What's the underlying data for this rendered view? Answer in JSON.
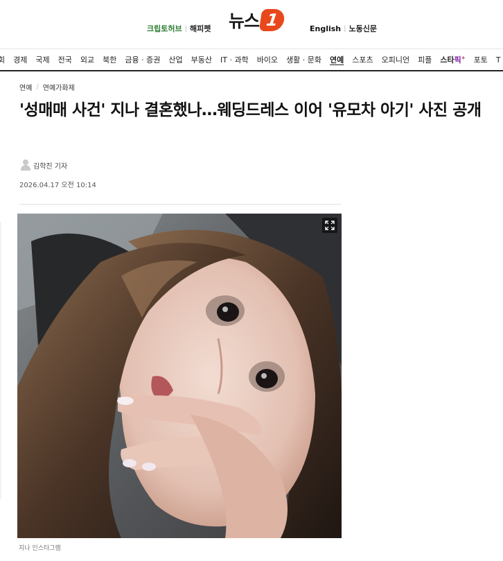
{
  "header": {
    "crypto_link": "크립토허브",
    "happy_link": "해피펫",
    "logo_word": "뉴스",
    "logo_badge": "1",
    "english_link": "English",
    "labor_link": "노동신문",
    "separator": "|"
  },
  "nav": {
    "items": [
      "회",
      "경제",
      "국제",
      "전국",
      "외교",
      "북한",
      "금융 · 증권",
      "산업",
      "부동산",
      "IT · 과학",
      "바이오",
      "생활 · 문화",
      "연예",
      "스포츠",
      "오피니언",
      "피플",
      "스타",
      "포토",
      "T"
    ],
    "active_index": 12,
    "star_index": 16,
    "star_suffix": "픽",
    "star_mark": "+"
  },
  "breadcrumb": {
    "section": "연예",
    "separator": "/",
    "subsection": "연예가화제"
  },
  "article": {
    "headline": "'성매매 사건' 지나 결혼했나…웨딩드레스 이어 '유모차 아기' 사진 공개",
    "author": "김학진 기자",
    "datetime": "2026.04.17 오전 10:14",
    "photo_caption": "지나 인스타그램"
  },
  "icons": {
    "expand": "expand-icon",
    "author_avatar": "person-icon"
  },
  "colors": {
    "logo_accent": "#e8481c",
    "crypto": "#2e7d32",
    "star": "#c2185b"
  }
}
